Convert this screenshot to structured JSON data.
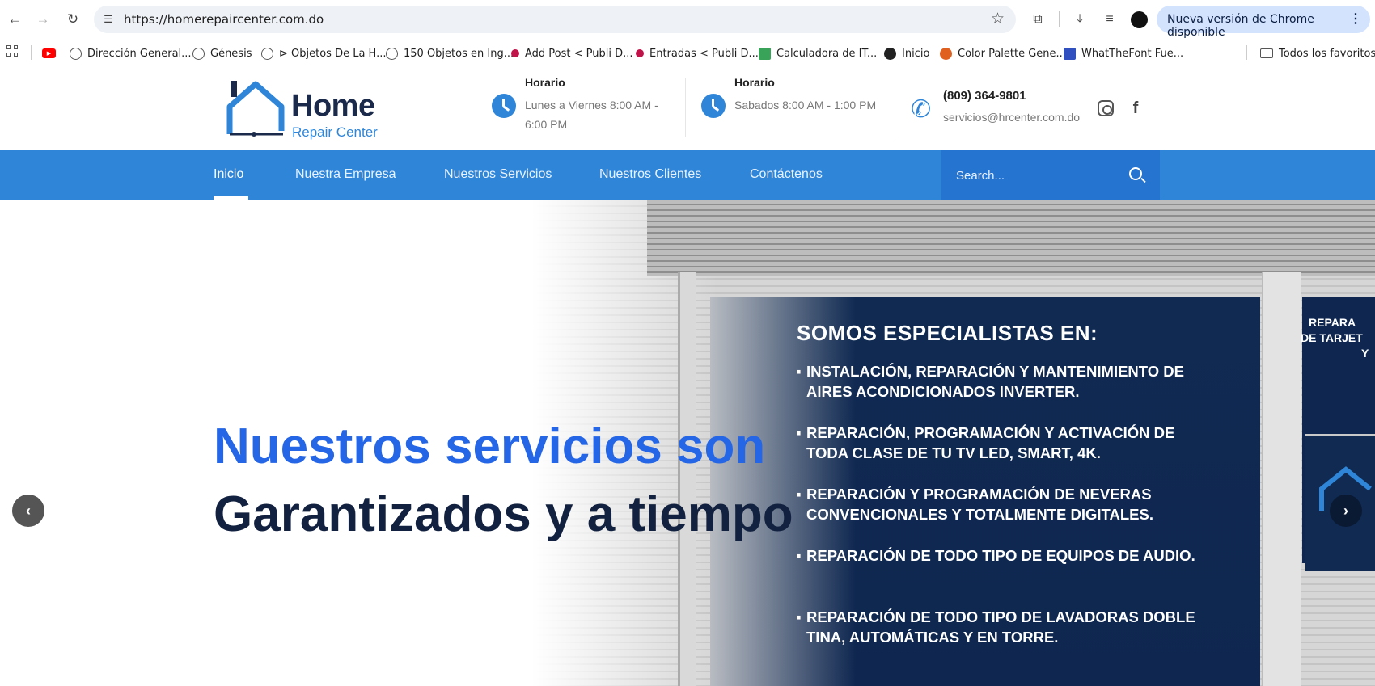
{
  "browser": {
    "url": "https://homerepaircenter.com.do",
    "update_label": "Nueva versión de Chrome disponible",
    "bookmarks": [
      {
        "label": "Dirección General...",
        "color": "#e02020"
      },
      {
        "label": "Génesis",
        "color": "#555555"
      },
      {
        "label": "⊳ Objetos De La H...",
        "color": "#555555"
      },
      {
        "label": "150 Objetos en Ing...",
        "color": "#555555"
      },
      {
        "label": "Add Post < Publi D...",
        "color": "#c0134a"
      },
      {
        "label": "Entradas < Publi D...",
        "color": "#c0134a"
      },
      {
        "label": "Calculadora de IT...",
        "color": "#3aa35a"
      },
      {
        "label": "Inicio",
        "color": "#222222"
      },
      {
        "label": "Color Palette Gene...",
        "color": "#e06020"
      },
      {
        "label": "WhatTheFont Fue...",
        "color": "#3050c0"
      }
    ],
    "all_bookmarks": "Todos los favoritos"
  },
  "header": {
    "logo_title": "Home",
    "logo_sub": "Repair Center",
    "schedule1": {
      "label": "Horario",
      "value": "Lunes a Viernes 8:00 AM - 6:00 PM"
    },
    "schedule2": {
      "label": "Horario",
      "value": "Sabados 8:00 AM - 1:00 PM"
    },
    "phone": "(809) 364-9801",
    "email": "servicios@hrcenter.com.do"
  },
  "nav": {
    "items": [
      "Inicio",
      "Nuestra Empresa",
      "Nuestros Servicios",
      "Nuestros Clientes",
      "Contáctenos"
    ],
    "search_placeholder": "Search..."
  },
  "hero": {
    "line1": "Nuestros servicios son",
    "line2": "Garantizados y a tiempo",
    "banner_title": "SOMOS ESPECIALISTAS EN:",
    "bullets": [
      "INSTALACIÓN, REPARACIÓN Y MANTENIMIENTO DE AIRES ACONDICIONADOS INVERTER.",
      "REPARACIÓN, PROGRAMACIÓN Y ACTIVACIÓN DE TODA CLASE DE TU TV LED, SMART, 4K.",
      "REPARACIÓN Y PROGRAMACIÓN DE NEVERAS CONVENCIONALES Y TOTALMENTE DIGITALES.",
      "REPARACIÓN DE TODO TIPO DE EQUIPOS DE AUDIO.",
      "REPARACIÓN DE TODO TIPO DE LAVADORAS DOBLE TINA, AUTOMÁTICAS Y EN TORRE."
    ],
    "right_lines": [
      "REPARA",
      "DE TARJET",
      "Y"
    ]
  },
  "colors": {
    "brand_blue": "#2f86d9",
    "headline_blue": "#2566e6",
    "headline_dark": "#12213f",
    "banner_navy": "#0f2750"
  }
}
